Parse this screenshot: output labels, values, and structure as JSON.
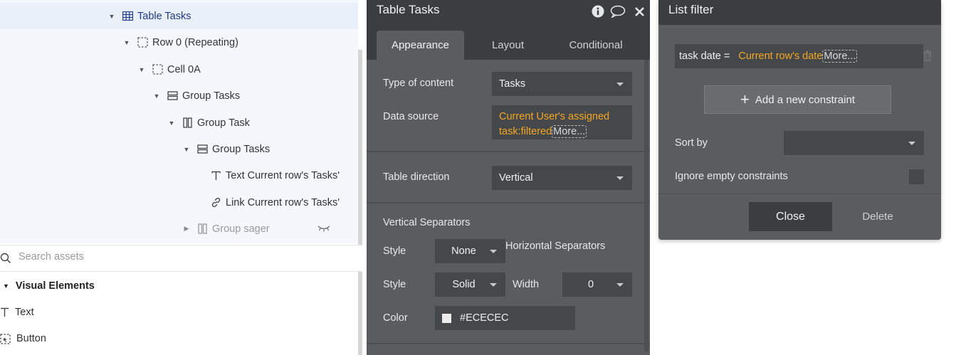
{
  "tree": {
    "items": [
      {
        "label": "Table Tasks",
        "icon": "table-icon"
      },
      {
        "label": "Row 0 (Repeating)",
        "icon": "dashed-box-icon"
      },
      {
        "label": "Cell 0A",
        "icon": "dashed-box-icon"
      },
      {
        "label": "Group Tasks",
        "icon": "group-rows-icon"
      },
      {
        "label": "Group Task",
        "icon": "group-columns-icon"
      },
      {
        "label": "Group Tasks",
        "icon": "group-rows-icon"
      },
      {
        "label": "Text Current row's Tasks'",
        "icon": "text-t-icon"
      },
      {
        "label": "Link Current row's Tasks'",
        "icon": "link-icon"
      },
      {
        "label": "Group sager",
        "icon": "group-columns-icon"
      }
    ]
  },
  "assets": {
    "search_placeholder": "Search assets",
    "section_title": "Visual Elements",
    "items": [
      "Text",
      "Button"
    ]
  },
  "editor": {
    "title": "Table Tasks",
    "tabs": [
      "Appearance",
      "Layout",
      "Conditional"
    ],
    "active_tab": "Appearance",
    "type_of_content_label": "Type of content",
    "type_of_content_value": "Tasks",
    "data_source_label": "Data source",
    "data_source_line1": "Current User's assigned",
    "data_source_line2": "task:filtered",
    "more_label": "More...",
    "table_direction_label": "Table direction",
    "table_direction_value": "Vertical",
    "vertical_separators_label": "Vertical Separators",
    "horizontal_separators_label": "Horizontal Separators",
    "style_label": "Style",
    "vertical_style_value": "None",
    "horizontal_style_value": "Solid",
    "width_label": "Width",
    "width_value": "0",
    "color_label": "Color",
    "color_value": "#ECECEC"
  },
  "filter": {
    "title": "List filter",
    "constraint_key": "task date =",
    "constraint_value": "Current row's date",
    "more_label": "More...",
    "add_constraint_label": "Add a new constraint",
    "sort_by_label": "Sort by",
    "sort_by_value": "",
    "ignore_empty_label": "Ignore empty constraints",
    "close_label": "Close",
    "delete_label": "Delete"
  },
  "colors": {
    "panel_bg": "#5a5d60",
    "title_bar": "#3b3e41",
    "field_bg": "#45484b",
    "dynamic_text": "#f5a623",
    "selected_row": "#e9f0fa"
  }
}
